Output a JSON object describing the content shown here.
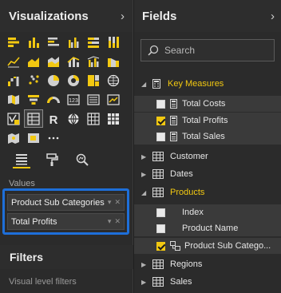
{
  "visualizations": {
    "title": "Visualizations",
    "chevron": "›",
    "values_label": "Values",
    "wells": [
      {
        "label": "Product Sub Categories"
      },
      {
        "label": "Total Profits"
      }
    ],
    "filters_title": "Filters",
    "filters_sub": "Visual level filters",
    "icons": [
      "stacked-bar-icon",
      "stacked-column-icon",
      "clustered-bar-icon",
      "clustered-column-icon",
      "100-bar-icon",
      "100-column-icon",
      "line-chart-icon",
      "area-chart-icon",
      "stacked-area-icon",
      "line-column-icon",
      "line-clustered-column-icon",
      "ribbon-chart-icon",
      "waterfall-icon",
      "scatter-icon",
      "pie-icon",
      "donut-icon",
      "treemap-icon",
      "map-icon",
      "filled-map-icon",
      "funnel-icon",
      "gauge-icon",
      "card-icon",
      "multirow-card-icon",
      "kpi-icon",
      "slicer-icon",
      "table-icon",
      "r-visual-icon",
      "globe-icon",
      "matrix-icon",
      "custom-visual-icon",
      "arcgis-icon",
      "shape-map-icon",
      "more-icon"
    ],
    "selected_icon": "table-icon"
  },
  "fields": {
    "title": "Fields",
    "chevron": "›",
    "search_placeholder": "Search",
    "rows": [
      {
        "label": "Key Measures",
        "kind": "table-measure",
        "highlight": true
      },
      {
        "label": "Total Costs",
        "kind": "measure",
        "checked": false
      },
      {
        "label": "Total Profits",
        "kind": "measure",
        "checked": true
      },
      {
        "label": "Total Sales",
        "kind": "measure",
        "checked": false
      },
      {
        "label": "Customer",
        "kind": "table"
      },
      {
        "label": "Dates",
        "kind": "table"
      },
      {
        "label": "Products",
        "kind": "table",
        "highlight": true,
        "expanded": true
      },
      {
        "label": "Index",
        "kind": "field",
        "checked": false
      },
      {
        "label": "Product Name",
        "kind": "field",
        "checked": false
      },
      {
        "label": "Product Sub Catego...",
        "kind": "hierarchy",
        "checked": true
      },
      {
        "label": "Regions",
        "kind": "table"
      },
      {
        "label": "Sales",
        "kind": "table"
      }
    ]
  },
  "colors": {
    "accent": "#f2c811",
    "focus_border": "#1e6fd9",
    "background": "#2b2b2b"
  }
}
